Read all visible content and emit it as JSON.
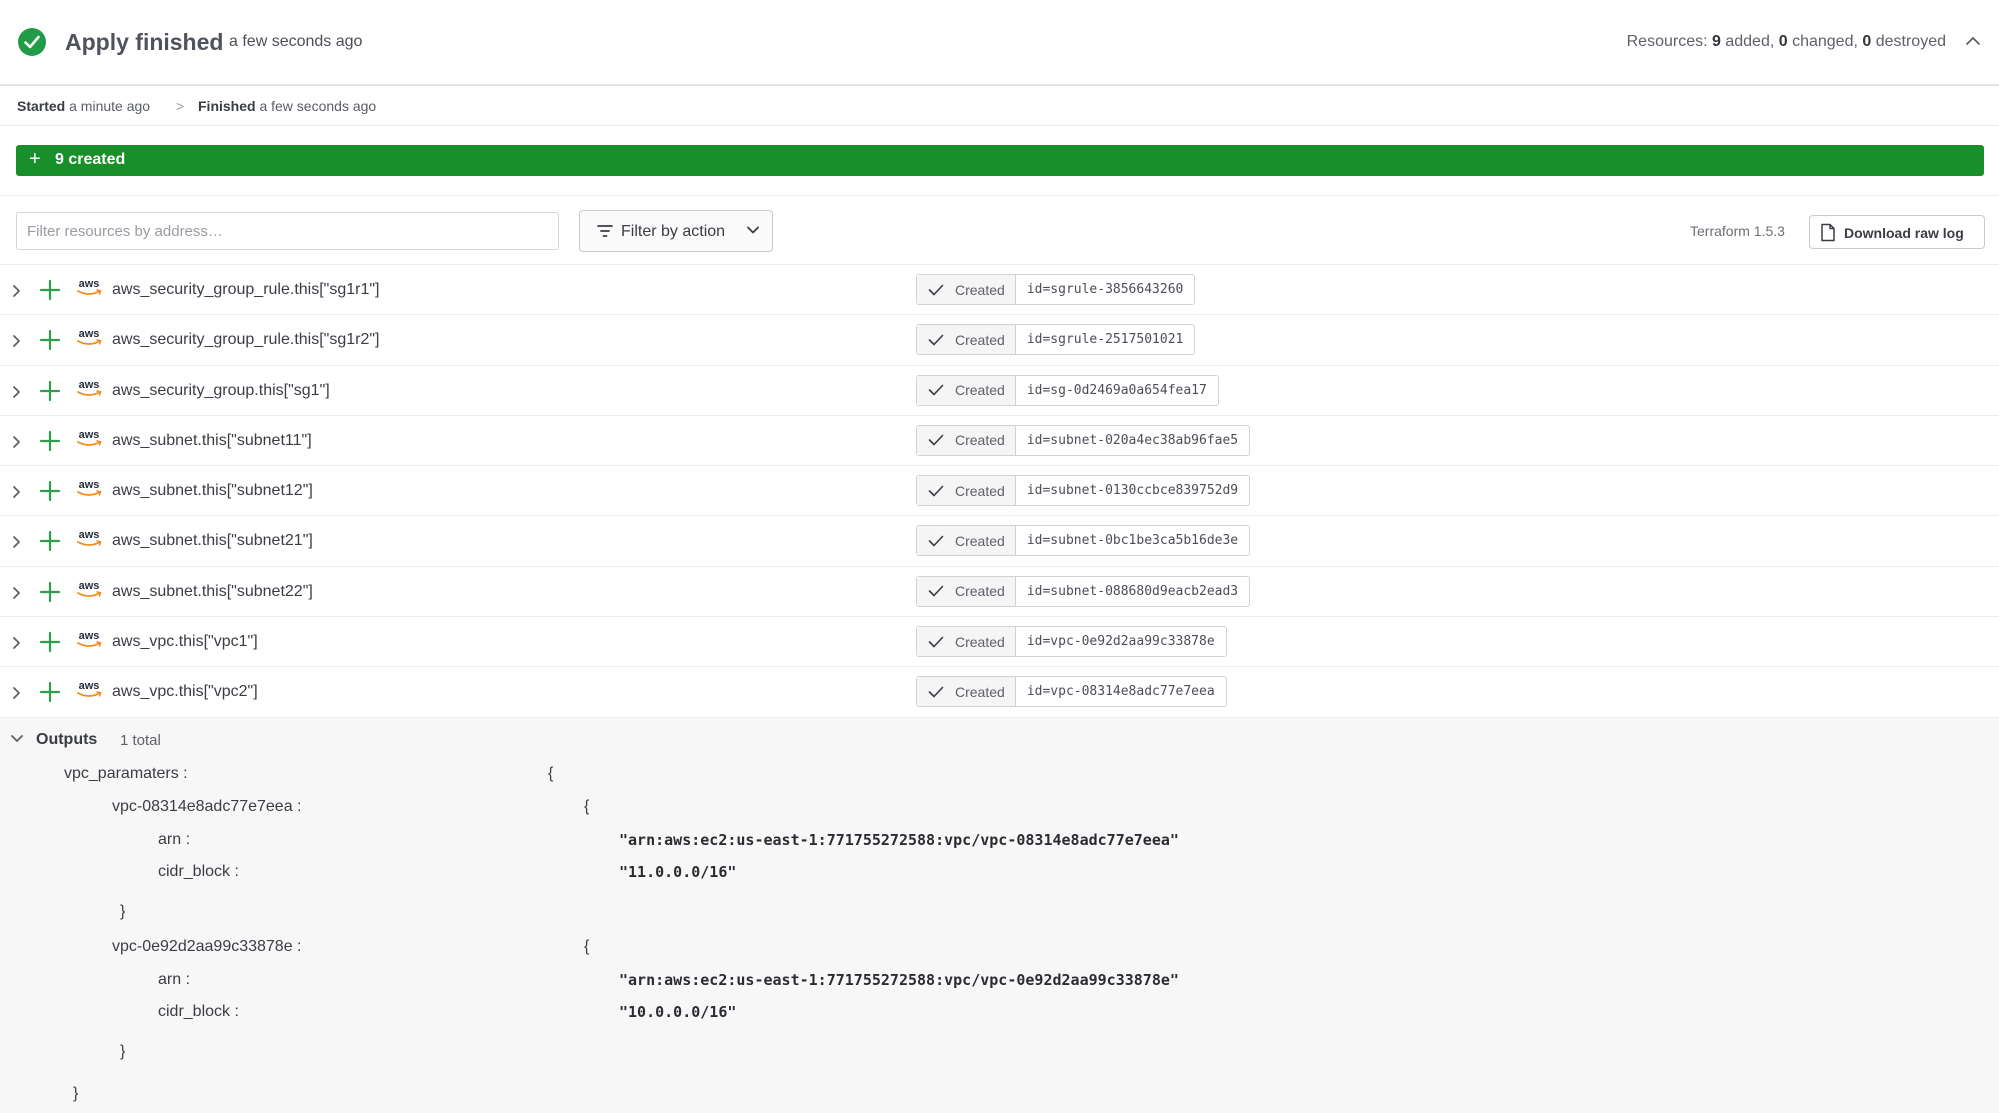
{
  "header": {
    "title": "Apply finished",
    "time": "a few seconds ago",
    "resources_prefix": "Resources: ",
    "added_count": "9",
    "added_label": " added, ",
    "changed_count": "0",
    "changed_label": " changed, ",
    "destroyed_count": "0",
    "destroyed_label": " destroyed"
  },
  "timeline": {
    "started_label": "Started",
    "started_time": "a minute ago",
    "separator": ">",
    "finished_label": "Finished",
    "finished_time": "a few seconds ago"
  },
  "summary": {
    "created_label": "9 created"
  },
  "filters": {
    "search_placeholder": "Filter resources by address…",
    "filter_by_action_label": "Filter by action",
    "terraform_version": "Terraform 1.5.3",
    "download_label": "Download raw log"
  },
  "resources": [
    {
      "provider": "aws",
      "address": "aws_security_group_rule.this[\"sg1r1\"]",
      "status": "Created",
      "id": "id=sgrule-3856643260"
    },
    {
      "provider": "aws",
      "address": "aws_security_group_rule.this[\"sg1r2\"]",
      "status": "Created",
      "id": "id=sgrule-2517501021"
    },
    {
      "provider": "aws",
      "address": "aws_security_group.this[\"sg1\"]",
      "status": "Created",
      "id": "id=sg-0d2469a0a654fea17"
    },
    {
      "provider": "aws",
      "address": "aws_subnet.this[\"subnet11\"]",
      "status": "Created",
      "id": "id=subnet-020a4ec38ab96fae5"
    },
    {
      "provider": "aws",
      "address": "aws_subnet.this[\"subnet12\"]",
      "status": "Created",
      "id": "id=subnet-0130ccbce839752d9"
    },
    {
      "provider": "aws",
      "address": "aws_subnet.this[\"subnet21\"]",
      "status": "Created",
      "id": "id=subnet-0bc1be3ca5b16de3e"
    },
    {
      "provider": "aws",
      "address": "aws_subnet.this[\"subnet22\"]",
      "status": "Created",
      "id": "id=subnet-088680d9eacb2ead3"
    },
    {
      "provider": "aws",
      "address": "aws_vpc.this[\"vpc1\"]",
      "status": "Created",
      "id": "id=vpc-0e92d2aa99c33878e"
    },
    {
      "provider": "aws",
      "address": "aws_vpc.this[\"vpc2\"]",
      "status": "Created",
      "id": "id=vpc-08314e8adc77e7eea"
    }
  ],
  "outputs": {
    "title": "Outputs",
    "count": "1 total",
    "root_key": "vpc_paramaters :",
    "open_brace": "{",
    "close_brace": "}",
    "entries": [
      {
        "key": "vpc-08314e8adc77e7eea :",
        "arn_key": "arn :",
        "arn_value": "\"arn:aws:ec2:us-east-1:771755272588:vpc/vpc-08314e8adc77e7eea\"",
        "cidr_key": "cidr_block :",
        "cidr_value": "\"11.0.0.0/16\""
      },
      {
        "key": "vpc-0e92d2aa99c33878e :",
        "arn_key": "arn :",
        "arn_value": "\"arn:aws:ec2:us-east-1:771755272588:vpc/vpc-0e92d2aa99c33878e\"",
        "cidr_key": "cidr_block :",
        "cidr_value": "\"10.0.0.0/16\""
      }
    ]
  },
  "colors": {
    "success_green": "#1f9c45",
    "created_bar": "#198f2b",
    "plus_green": "#2e9e4a",
    "aws_orange": "#f08c1a"
  }
}
